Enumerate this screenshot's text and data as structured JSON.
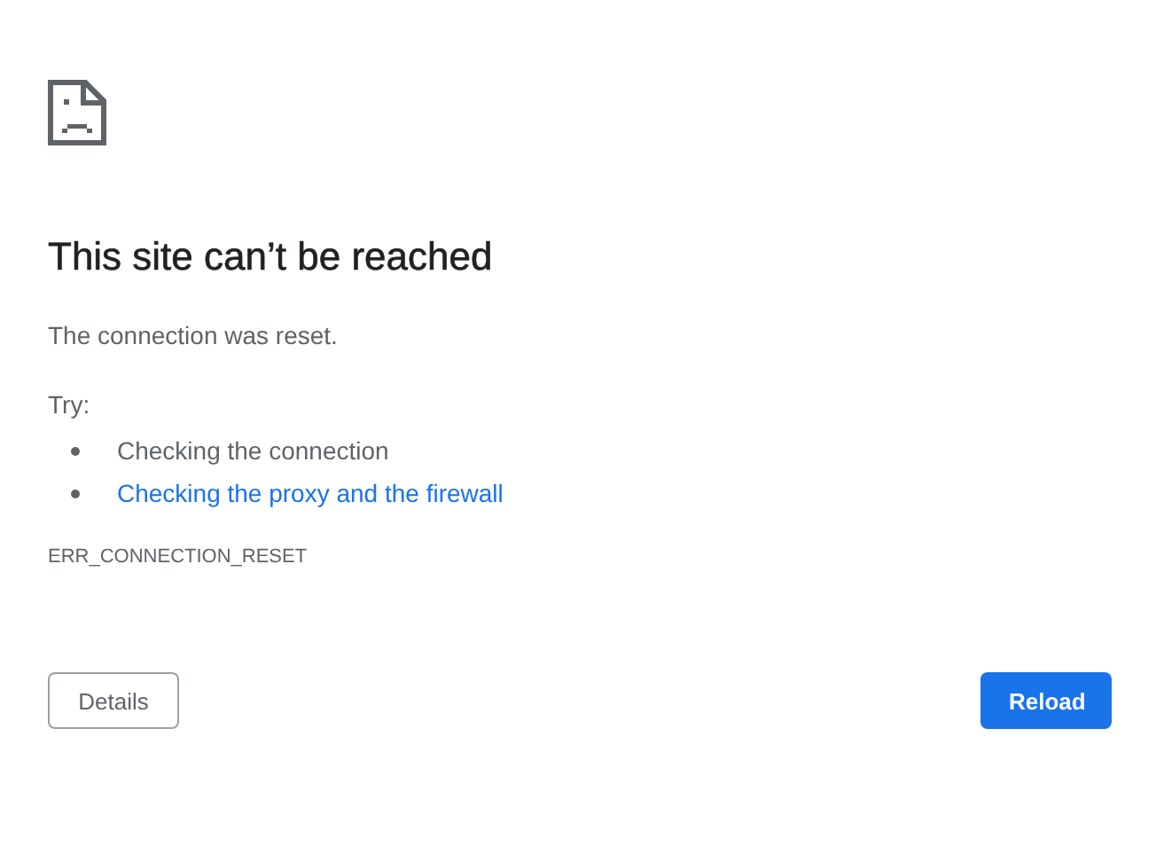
{
  "title": "This site can’t be reached",
  "message": "The connection was reset.",
  "try_label": "Try:",
  "suggestions": [
    {
      "kind": "text",
      "text": "Checking the connection"
    },
    {
      "kind": "link",
      "text": "Checking the proxy and the firewall"
    }
  ],
  "error_code": "ERR_CONNECTION_RESET",
  "buttons": [
    {
      "kind": "secondary",
      "label": "Details"
    },
    {
      "kind": "primary",
      "label": "Reload"
    }
  ]
}
